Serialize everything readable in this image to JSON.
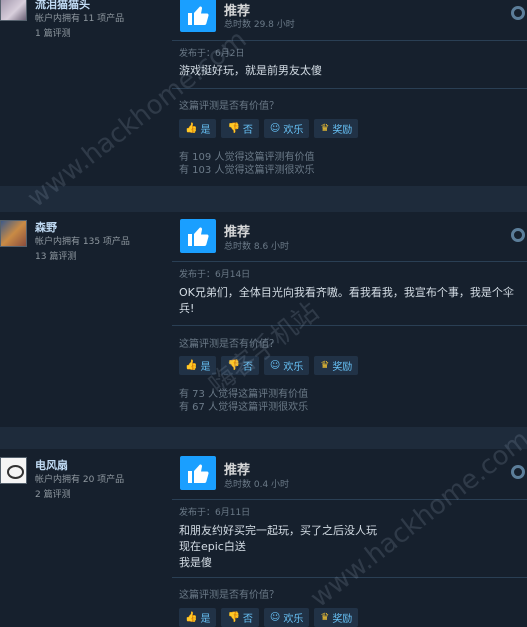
{
  "reviews": [
    {
      "user_name": "流泪猫猫头",
      "products": "帐户内拥有 11 项产品",
      "review_count": "1 篇评测",
      "recommend": "推荐",
      "hours": "总时数 29.8 小时",
      "posted": "发布于：6月2日",
      "text": "游戏挺好玩，就是前男友太傻",
      "helpful_question": "这篇评测是否有价值？",
      "buttons": {
        "yes": "是",
        "no": "否",
        "funny": "欢乐",
        "award": "奖励"
      },
      "helpful_count": "有 109 人觉得这篇评测有价值",
      "funny_count": "有 103 人觉得这篇评测很欢乐"
    },
    {
      "user_name": "森野",
      "products": "帐户内拥有 135 项产品",
      "review_count": "13 篇评测",
      "recommend": "推荐",
      "hours": "总时数 8.6 小时",
      "posted": "发布于：6月14日",
      "text": "OK兄弟们，全体目光向我看齐嗷。看我看我，我宣布个事，我是个伞兵!",
      "helpful_question": "这篇评测是否有价值？",
      "buttons": {
        "yes": "是",
        "no": "否",
        "funny": "欢乐",
        "award": "奖励"
      },
      "helpful_count": "有 73 人觉得这篇评测有价值",
      "funny_count": "有 67 人觉得这篇评测很欢乐"
    },
    {
      "user_name": "电风扇",
      "products": "帐户内拥有 20 项产品",
      "review_count": "2 篇评测",
      "recommend": "推荐",
      "hours": "总时数 0.4 小时",
      "posted": "发布于：6月11日",
      "text_lines": [
        "和朋友约好买完一起玩，买了之后没人玩",
        "现在epic白送",
        "我是傻"
      ],
      "helpful_question": "这篇评测是否有价值？",
      "buttons": {
        "yes": "是",
        "no": "否",
        "funny": "欢乐",
        "award": "奖励"
      }
    }
  ],
  "watermarks": [
    "www.hackhome.com",
    "嗨客手机站",
    "www.hackhome.com"
  ],
  "colors": {
    "thumb": "#1a9fff",
    "link": "#67c1f5",
    "background": "#1b2838"
  }
}
